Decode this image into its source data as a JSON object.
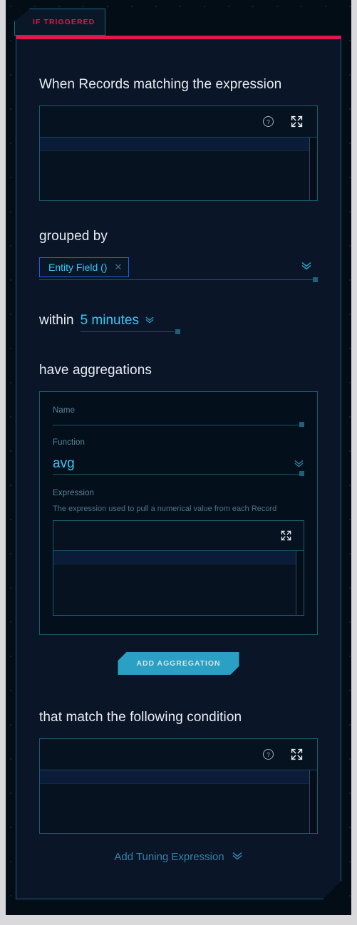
{
  "tab": {
    "label": "IF TRIGGERED",
    "accent_color": "#e0194d"
  },
  "theme": {
    "panel_bg": "#0b1528",
    "canvas_bg": "#030d15",
    "border": "#1b5f7e",
    "accent_cyan": "#36c8f5",
    "accent_red": "#e0194d",
    "muted_text": "#5e8499"
  },
  "sections": {
    "when": {
      "heading": "When Records matching the expression",
      "editor": {
        "help_icon": "help-circle-icon",
        "expand_icon": "expand-arrows-icon",
        "value": ""
      }
    },
    "grouped_by": {
      "heading": "grouped by",
      "chip": {
        "label": "Entity Field ()",
        "remove_icon": "close-icon"
      },
      "dropdown_icon": "chevron-double-down-icon"
    },
    "within": {
      "prefix": "within",
      "value": "5 minutes",
      "dropdown_icon": "chevron-double-down-icon"
    },
    "aggregations": {
      "heading": "have aggregations",
      "card": {
        "name": {
          "label": "Name",
          "value": ""
        },
        "function": {
          "label": "Function",
          "value": "avg",
          "dropdown_icon": "chevron-double-down-icon"
        },
        "expression": {
          "label": "Expression",
          "description": "The expression used to pull a numerical value from each Record",
          "expand_icon": "expand-arrows-icon",
          "value": ""
        }
      },
      "add_button": "ADD AGGREGATION"
    },
    "condition": {
      "heading": "that match the following condition",
      "editor": {
        "help_icon": "help-circle-icon",
        "expand_icon": "expand-arrows-icon",
        "value": ""
      }
    },
    "tuning": {
      "label": "Add Tuning Expression",
      "icon": "chevron-double-down-icon"
    }
  }
}
